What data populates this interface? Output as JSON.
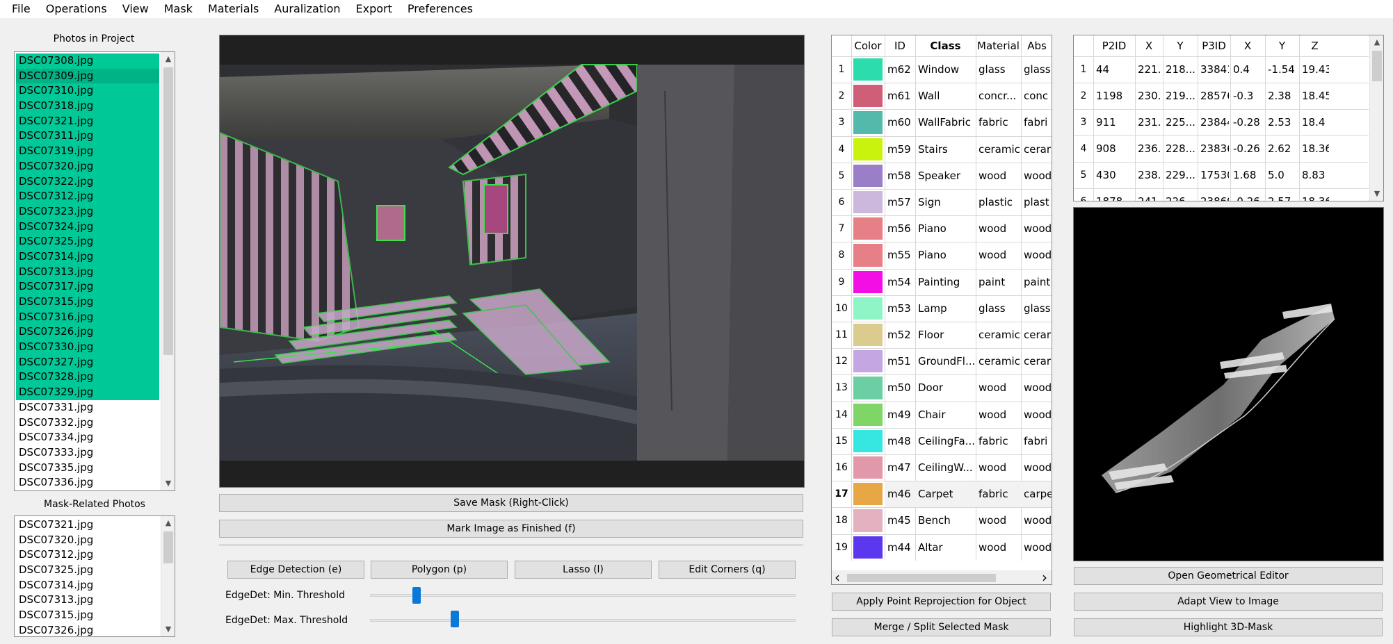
{
  "menu": [
    "File",
    "Operations",
    "View",
    "Mask",
    "Materials",
    "Auralization",
    "Export",
    "Preferences"
  ],
  "photos_panel": {
    "title": "Photos in Project",
    "items": [
      {
        "name": "DSC07308.jpg",
        "selected": true
      },
      {
        "name": "DSC07309.jpg",
        "selected": true,
        "current": true
      },
      {
        "name": "DSC07310.jpg",
        "selected": true
      },
      {
        "name": "DSC07318.jpg",
        "selected": true
      },
      {
        "name": "DSC07321.jpg",
        "selected": true
      },
      {
        "name": "DSC07311.jpg",
        "selected": true
      },
      {
        "name": "DSC07319.jpg",
        "selected": true
      },
      {
        "name": "DSC07320.jpg",
        "selected": true
      },
      {
        "name": "DSC07322.jpg",
        "selected": true
      },
      {
        "name": "DSC07312.jpg",
        "selected": true
      },
      {
        "name": "DSC07323.jpg",
        "selected": true
      },
      {
        "name": "DSC07324.jpg",
        "selected": true
      },
      {
        "name": "DSC07325.jpg",
        "selected": true
      },
      {
        "name": "DSC07314.jpg",
        "selected": true
      },
      {
        "name": "DSC07313.jpg",
        "selected": true
      },
      {
        "name": "DSC07317.jpg",
        "selected": true
      },
      {
        "name": "DSC07315.jpg",
        "selected": true
      },
      {
        "name": "DSC07316.jpg",
        "selected": true
      },
      {
        "name": "DSC07326.jpg",
        "selected": true
      },
      {
        "name": "DSC07330.jpg",
        "selected": true
      },
      {
        "name": "DSC07327.jpg",
        "selected": true
      },
      {
        "name": "DSC07328.jpg",
        "selected": true
      },
      {
        "name": "DSC07329.jpg",
        "selected": true
      },
      {
        "name": "DSC07331.jpg",
        "selected": false
      },
      {
        "name": "DSC07332.jpg",
        "selected": false
      },
      {
        "name": "DSC07334.jpg",
        "selected": false
      },
      {
        "name": "DSC07333.jpg",
        "selected": false
      },
      {
        "name": "DSC07335.jpg",
        "selected": false
      },
      {
        "name": "DSC07336.jpg",
        "selected": false
      }
    ]
  },
  "related_panel": {
    "title": "Mask-Related Photos",
    "items": [
      "DSC07321.jpg",
      "DSC07320.jpg",
      "DSC07312.jpg",
      "DSC07325.jpg",
      "DSC07314.jpg",
      "DSC07313.jpg",
      "DSC07315.jpg",
      "DSC07326.jpg"
    ]
  },
  "buttons": {
    "save_mask": "Save Mask (Right-Click)",
    "mark_finished": "Mark Image as Finished (f)",
    "tools": [
      "Edge Detection (e)",
      "Polygon (p)",
      "Lasso (l)",
      "Edit Corners (q)"
    ],
    "apply_reprojection": "Apply Point Reprojection for Object",
    "merge_split": "Merge / Split Selected Mask",
    "open_geo_editor": "Open Geometrical Editor",
    "adapt_view": "Adapt View to Image",
    "highlight_3d": "Highlight 3D-Mask"
  },
  "sliders": [
    {
      "label": "EdgeDet: Min. Threshold",
      "value": 0.11
    },
    {
      "label": "EdgeDet: Max. Threshold",
      "value": 0.2
    }
  ],
  "mask_table": {
    "headers": [
      "Color",
      "ID",
      "Class",
      "Material",
      "Abs"
    ],
    "selected_row": 17,
    "rows": [
      {
        "n": "1",
        "color": "#2ddcac",
        "id": "m62",
        "class": "Window",
        "material": "glass",
        "abs": "glass"
      },
      {
        "n": "2",
        "color": "#cf5f78",
        "id": "m61",
        "class": "Wall",
        "material": "concr...",
        "abs": "conc"
      },
      {
        "n": "3",
        "color": "#52b9ab",
        "id": "m60",
        "class": "WallFabric",
        "material": "fabric",
        "abs": "fabri"
      },
      {
        "n": "4",
        "color": "#c9f20c",
        "id": "m59",
        "class": "Stairs",
        "material": "ceramic",
        "abs": "cerar"
      },
      {
        "n": "5",
        "color": "#9b7ec8",
        "id": "m58",
        "class": "Speaker",
        "material": "wood",
        "abs": "wood"
      },
      {
        "n": "6",
        "color": "#cbb8dc",
        "id": "m57",
        "class": "Sign",
        "material": "plastic",
        "abs": "plast"
      },
      {
        "n": "7",
        "color": "#e67f86",
        "id": "m56",
        "class": "Piano",
        "material": "wood",
        "abs": "wood"
      },
      {
        "n": "8",
        "color": "#e67f86",
        "id": "m55",
        "class": "Piano",
        "material": "wood",
        "abs": "wood"
      },
      {
        "n": "9",
        "color": "#f40ee6",
        "id": "m54",
        "class": "Painting",
        "material": "paint",
        "abs": "paint"
      },
      {
        "n": "10",
        "color": "#8ff5c6",
        "id": "m53",
        "class": "Lamp",
        "material": "glass",
        "abs": "glass"
      },
      {
        "n": "11",
        "color": "#dbcb8e",
        "id": "m52",
        "class": "Floor",
        "material": "ceramic",
        "abs": "cerar"
      },
      {
        "n": "12",
        "color": "#c3a6e2",
        "id": "m51",
        "class": "GroundFl...",
        "material": "ceramic",
        "abs": "cerar"
      },
      {
        "n": "13",
        "color": "#6ccfa4",
        "id": "m50",
        "class": "Door",
        "material": "wood",
        "abs": "wood"
      },
      {
        "n": "14",
        "color": "#7fd666",
        "id": "m49",
        "class": "Chair",
        "material": "wood",
        "abs": "wood"
      },
      {
        "n": "15",
        "color": "#35e7e0",
        "id": "m48",
        "class": "CeilingFa...",
        "material": "fabric",
        "abs": "fabri"
      },
      {
        "n": "16",
        "color": "#e198a8",
        "id": "m47",
        "class": "CeilingW...",
        "material": "wood",
        "abs": "wood"
      },
      {
        "n": "17",
        "color": "#e7a746",
        "id": "m46",
        "class": "Carpet",
        "material": "fabric",
        "abs": "carpe"
      },
      {
        "n": "18",
        "color": "#e4b1c1",
        "id": "m45",
        "class": "Bench",
        "material": "wood",
        "abs": "wood"
      },
      {
        "n": "19",
        "color": "#5b37ee",
        "id": "m44",
        "class": "Altar",
        "material": "wood",
        "abs": "wood"
      }
    ]
  },
  "points_table": {
    "headers": [
      "P2ID",
      "X",
      "Y",
      "P3ID",
      "X",
      "Y",
      "Z"
    ],
    "rows": [
      [
        "1",
        "44",
        "221....",
        "218....",
        "33841",
        "0.4",
        "-1.54",
        "19.43"
      ],
      [
        "2",
        "1198",
        "230....",
        "219....",
        "28576",
        "-0.3",
        "2.38",
        "18.45"
      ],
      [
        "3",
        "911",
        "231.6",
        "225....",
        "23844",
        "-0.28",
        "2.53",
        "18.4"
      ],
      [
        "4",
        "908",
        "236....",
        "228....",
        "23836",
        "-0.26",
        "2.62",
        "18.36"
      ],
      [
        "5",
        "430",
        "238....",
        "229....",
        "17530",
        "1.68",
        "5.0",
        "8.83"
      ],
      [
        "6",
        "1878",
        "241",
        "226",
        "23869",
        "-0.26",
        "2.57",
        "18.36"
      ]
    ]
  }
}
